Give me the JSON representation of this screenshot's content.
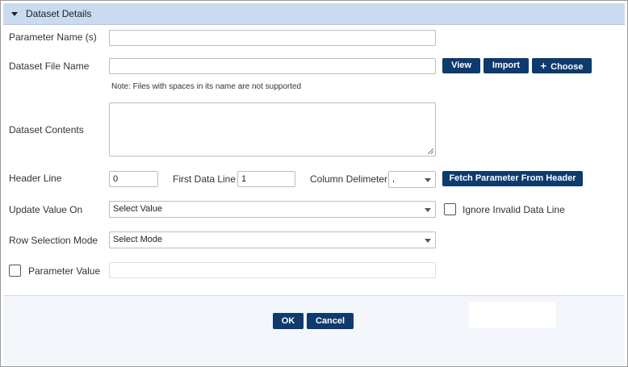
{
  "section": {
    "title": "Dataset Details"
  },
  "fields": {
    "parameter_name": {
      "label": "Parameter Name (s)",
      "value": ""
    },
    "dataset_file_name": {
      "label": "Dataset File Name",
      "value": ""
    },
    "note": "Note: Files with spaces in its name are not supported",
    "dataset_contents": {
      "label": "Dataset Contents",
      "value": ""
    },
    "header_line": {
      "label": "Header Line",
      "value": "0"
    },
    "first_data_line": {
      "label": "First Data Line",
      "value": "1"
    },
    "column_delimiter": {
      "label": "Column Delimeter",
      "value": ","
    },
    "update_value_on": {
      "label": "Update Value On",
      "value": "Select Value"
    },
    "ignore_invalid": {
      "label": "Ignore Invalid Data Line",
      "checked": false
    },
    "row_selection_mode": {
      "label": "Row Selection Mode",
      "value": "Select Mode"
    },
    "parameter_value": {
      "label": "Parameter Value",
      "checked": false,
      "value": ""
    }
  },
  "buttons": {
    "view": "View",
    "import": "Import",
    "choose": "Choose",
    "fetch": "Fetch Parameter From Header",
    "ok": "OK",
    "cancel": "Cancel"
  },
  "icons": {
    "section_toggle": "caret-down-icon",
    "choose": "plus-icon",
    "select_arrow": "chevron-down-icon"
  },
  "colors": {
    "header_bg": "#c9dbef",
    "button_bg": "#0f3a6e",
    "footer_bg": "#f3f6fa"
  }
}
